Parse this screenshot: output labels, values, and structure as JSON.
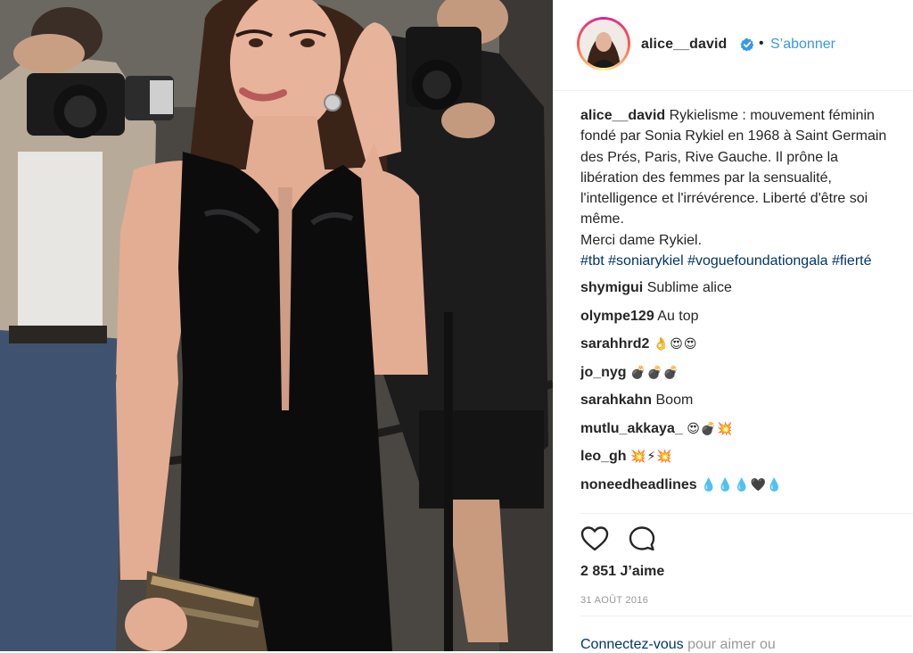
{
  "post": {
    "username": "alice__david",
    "follow_label": "S’abonner",
    "separator": "•",
    "caption": {
      "username": "alice__david",
      "text": "Rykielisme : mouvement féminin fondé par Sonia Rykiel en 1968 à Saint Germain des Prés, Paris, Rive Gauche. Il prône la libération des femmes par la sensualité, l'intelligence et l'irrévérence. Liberté d'être soi même.\nMerci dame Rykiel.",
      "hashtags": [
        "#tbt",
        "#soniarykiel",
        "#voguefoundationgala",
        "#fierté"
      ]
    },
    "comments": [
      {
        "user": "shymigui",
        "text": "Sublime alice"
      },
      {
        "user": "olympe129",
        "text": "Au top"
      },
      {
        "user": "sarahhrd2",
        "text": "👌😍😍"
      },
      {
        "user": "jo_nyg",
        "text": "💣💣💣"
      },
      {
        "user": "sarahkahn",
        "text": "Boom"
      },
      {
        "user": "mutlu_akkaya_",
        "text": "😍💣💥"
      },
      {
        "user": "leo_gh",
        "text": "💥⚡💥"
      },
      {
        "user": "noneedheadlines",
        "text": "💧💧💧🖤💧"
      }
    ],
    "likes": "2 851 J’aime",
    "date": "31 AOÛT 2016",
    "login_prompt": {
      "link": "Connectez-vous",
      "rest": " pour aimer ou"
    },
    "icons": {
      "like": "heart-icon",
      "comment": "comment-icon",
      "verified": "verified-badge-icon"
    },
    "colors": {
      "follow": "#3897f0",
      "hashtag": "#003569",
      "verified": "#3897f0",
      "muted": "#999999"
    }
  }
}
